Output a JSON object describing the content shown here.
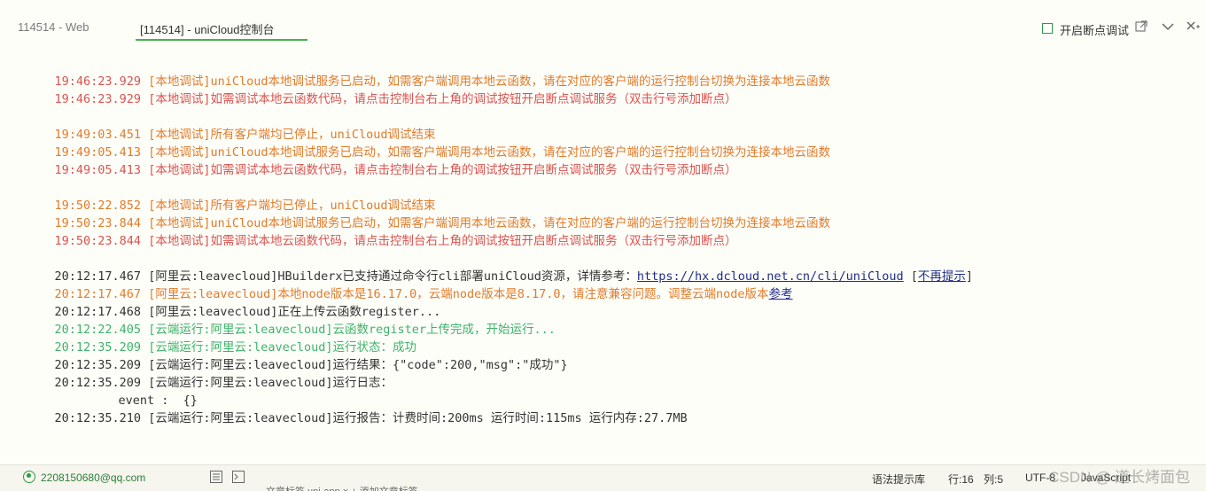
{
  "tabs": {
    "tab1": "114514 - Web",
    "tab2": "[114514] - uniCloud控制台"
  },
  "toolbar": {
    "breakpoint_label": "开启断点调试"
  },
  "console": {
    "l1_time": "19:46:23.929",
    "l1_text": "[本地调试]uniCloud本地调试服务已启动，如需客户端调用本地云函数，请在对应的客户端的运行控制台切换为连接本地云函数",
    "l2_time": "19:46:23.929",
    "l2_text": "[本地调试]如需调试本地云函数代码，请点击控制台右上角的调试按钮开启断点调试服务（双击行号添加断点）",
    "l3_time": "19:49:03.451",
    "l3_text": "[本地调试]所有客户端均已停止，uniCloud调试结束",
    "l4_time": "19:49:05.413",
    "l4_text": "[本地调试]uniCloud本地调试服务已启动，如需客户端调用本地云函数，请在对应的客户端的运行控制台切换为连接本地云函数",
    "l5_time": "19:49:05.413",
    "l5_text": "[本地调试]如需调试本地云函数代码，请点击控制台右上角的调试按钮开启断点调试服务（双击行号添加断点）",
    "l6_time": "19:50:22.852",
    "l6_text": "[本地调试]所有客户端均已停止，uniCloud调试结束",
    "l7_time": "19:50:23.844",
    "l7_text": "[本地调试]uniCloud本地调试服务已启动，如需客户端调用本地云函数，请在对应的客户端的运行控制台切换为连接本地云函数",
    "l8_time": "19:50:23.844",
    "l8_text": "[本地调试]如需调试本地云函数代码，请点击控制台右上角的调试按钮开启断点调试服务（双击行号添加断点）",
    "l9_time": "20:12:17.467",
    "l9_text": "[阿里云:leavecloud]HBuilderx已支持通过命令行cli部署uniCloud资源，详情参考：",
    "l9_link": "https://hx.dcloud.net.cn/cli/uniCloud",
    "l9_open": " [",
    "l9_link2": "不再提示",
    "l9_close": "]",
    "l10_time": "20:12:17.467",
    "l10_text": "[阿里云:leavecloud]本地node版本是16.17.0，云端node版本是8.17.0，请注意兼容问题。调整云端node版本",
    "l10_link": "参考",
    "l11_time": "20:12:17.468",
    "l11_text": "[阿里云:leavecloud]正在上传云函数register...",
    "l12_time": "20:12:22.405",
    "l12_text": "[云端运行:阿里云:leavecloud]云函数register上传完成，开始运行...",
    "l13_time": "20:12:35.209",
    "l13_text": "[云端运行:阿里云:leavecloud]运行状态：成功",
    "l14_time": "20:12:35.209",
    "l14_text": "[云端运行:阿里云:leavecloud]运行结果：{\"code\":200,\"msg\":\"成功\"}",
    "l15_time": "20:12:35.209",
    "l15_text": "[云端运行:阿里云:leavecloud]运行日志：",
    "l16_text": "event :  {}",
    "l17_time": "20:12:35.210",
    "l17_text": "[云端运行:阿里云:leavecloud]运行报告：计费时间:200ms 运行时间:115ms 运行内存:27.7MB"
  },
  "statusbar": {
    "user": "2208150680@qq.com",
    "syntax": "语法提示库",
    "row": "行:16",
    "col": "列:5",
    "encoding": "UTF-8",
    "lang": "JavaScript",
    "watermark": "CSDN @ 道长烤面包"
  },
  "below": {
    "strip": "文章标签    uni-app  ×   + 添加文章标签"
  },
  "colors": {
    "accent_green": "#4caf50",
    "error_red": "#d9534f",
    "warn_orange": "#e07b2a",
    "success_green": "#3db36b"
  }
}
